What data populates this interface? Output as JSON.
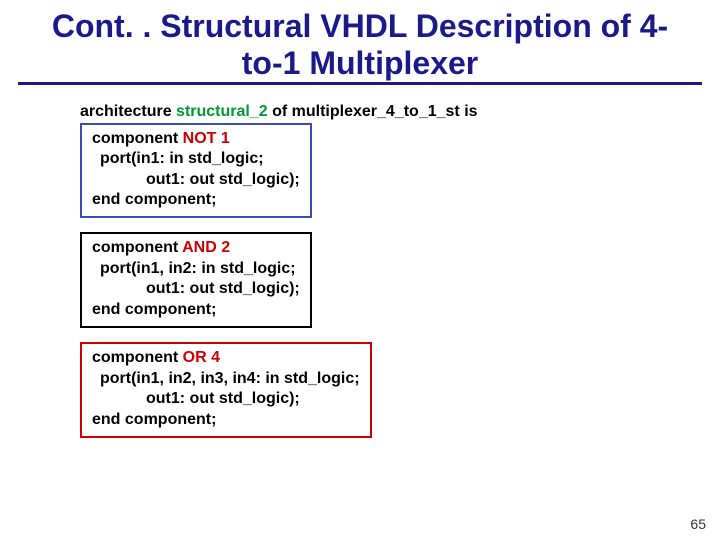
{
  "title": "Cont. . Structural VHDL Description of 4-to-1 Multiplexer",
  "arch": {
    "kw_architecture": "architecture",
    "name": "structural_2",
    "kw_of": "of",
    "entity": "multiplexer_4_to_1_st",
    "kw_is": "is"
  },
  "box1": {
    "l1a": "component ",
    "l1b": "NOT 1",
    "l2": "port(in1: in std_logic;",
    "l3": "out1: out std_logic);",
    "l4": "end component;"
  },
  "box2": {
    "l1a": "component ",
    "l1b": "AND 2",
    "l2": "port(in1, in2: in std_logic;",
    "l3": "out1: out std_logic);",
    "l4": "end component;"
  },
  "box3": {
    "l1a": "component ",
    "l1b": "OR 4",
    "l2": "port(in1, in2, in3, in4: in std_logic;",
    "l3": "out1: out std_logic);",
    "l4": "end component;"
  },
  "pageNumber": "65"
}
